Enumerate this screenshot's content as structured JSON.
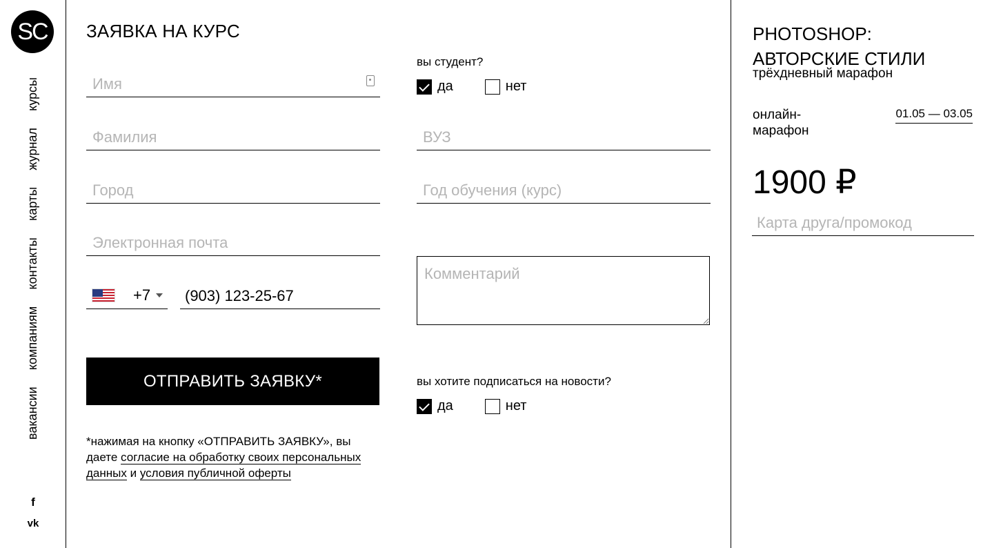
{
  "logo": {
    "text": "SC"
  },
  "nav": {
    "items": [
      {
        "label": "курсы"
      },
      {
        "label": "журнал"
      },
      {
        "label": "карты"
      },
      {
        "label": "контакты"
      },
      {
        "label": "компаниям"
      },
      {
        "label": "вакансии"
      }
    ]
  },
  "social": {
    "facebook": "f",
    "vk": "vk"
  },
  "form": {
    "title": "ЗАЯВКА НА КУРС",
    "name_placeholder": "Имя",
    "surname_placeholder": "Фамилия",
    "city_placeholder": "Город",
    "email_placeholder": "Электронная почта",
    "phone_code": "+7",
    "phone_value": "(903) 123-25-67",
    "student_question": "вы студент?",
    "student_yes": "да",
    "student_no": "нет",
    "student_yes_checked": true,
    "student_no_checked": false,
    "university_placeholder": "ВУЗ",
    "study_year_placeholder": "Год обучения (курс)",
    "comment_placeholder": "Комментарий",
    "newsletter_question": "вы хотите подписаться на новости?",
    "newsletter_yes": "да",
    "newsletter_no": "нет",
    "newsletter_yes_checked": true,
    "newsletter_no_checked": false,
    "submit_label": "ОТПРАВИТЬ ЗАЯВКУ*",
    "consent_prefix": "*нажимая на кнопку «ОТПРАВИТЬ ЗАЯВКУ», вы даете ",
    "consent_link_1": "согласие на обработку своих персональных данных",
    "consent_middle": " и ",
    "consent_link_2": "условия публичной оферты"
  },
  "course": {
    "title_line1": "PHOTOSHOP:",
    "title_line2": "АВТОРСКИЕ СТИЛИ",
    "subtitle": "трёхдневный марафон",
    "format_line1": "онлайн-",
    "format_line2": "марафон",
    "dates": "01.05 — 03.05",
    "price": "1900 ₽",
    "promo_placeholder": "Карта друга/промокод"
  },
  "colors": {
    "text": "#000000",
    "placeholder": "#b5b5b5",
    "button_bg": "#000000",
    "button_text": "#ffffff"
  }
}
